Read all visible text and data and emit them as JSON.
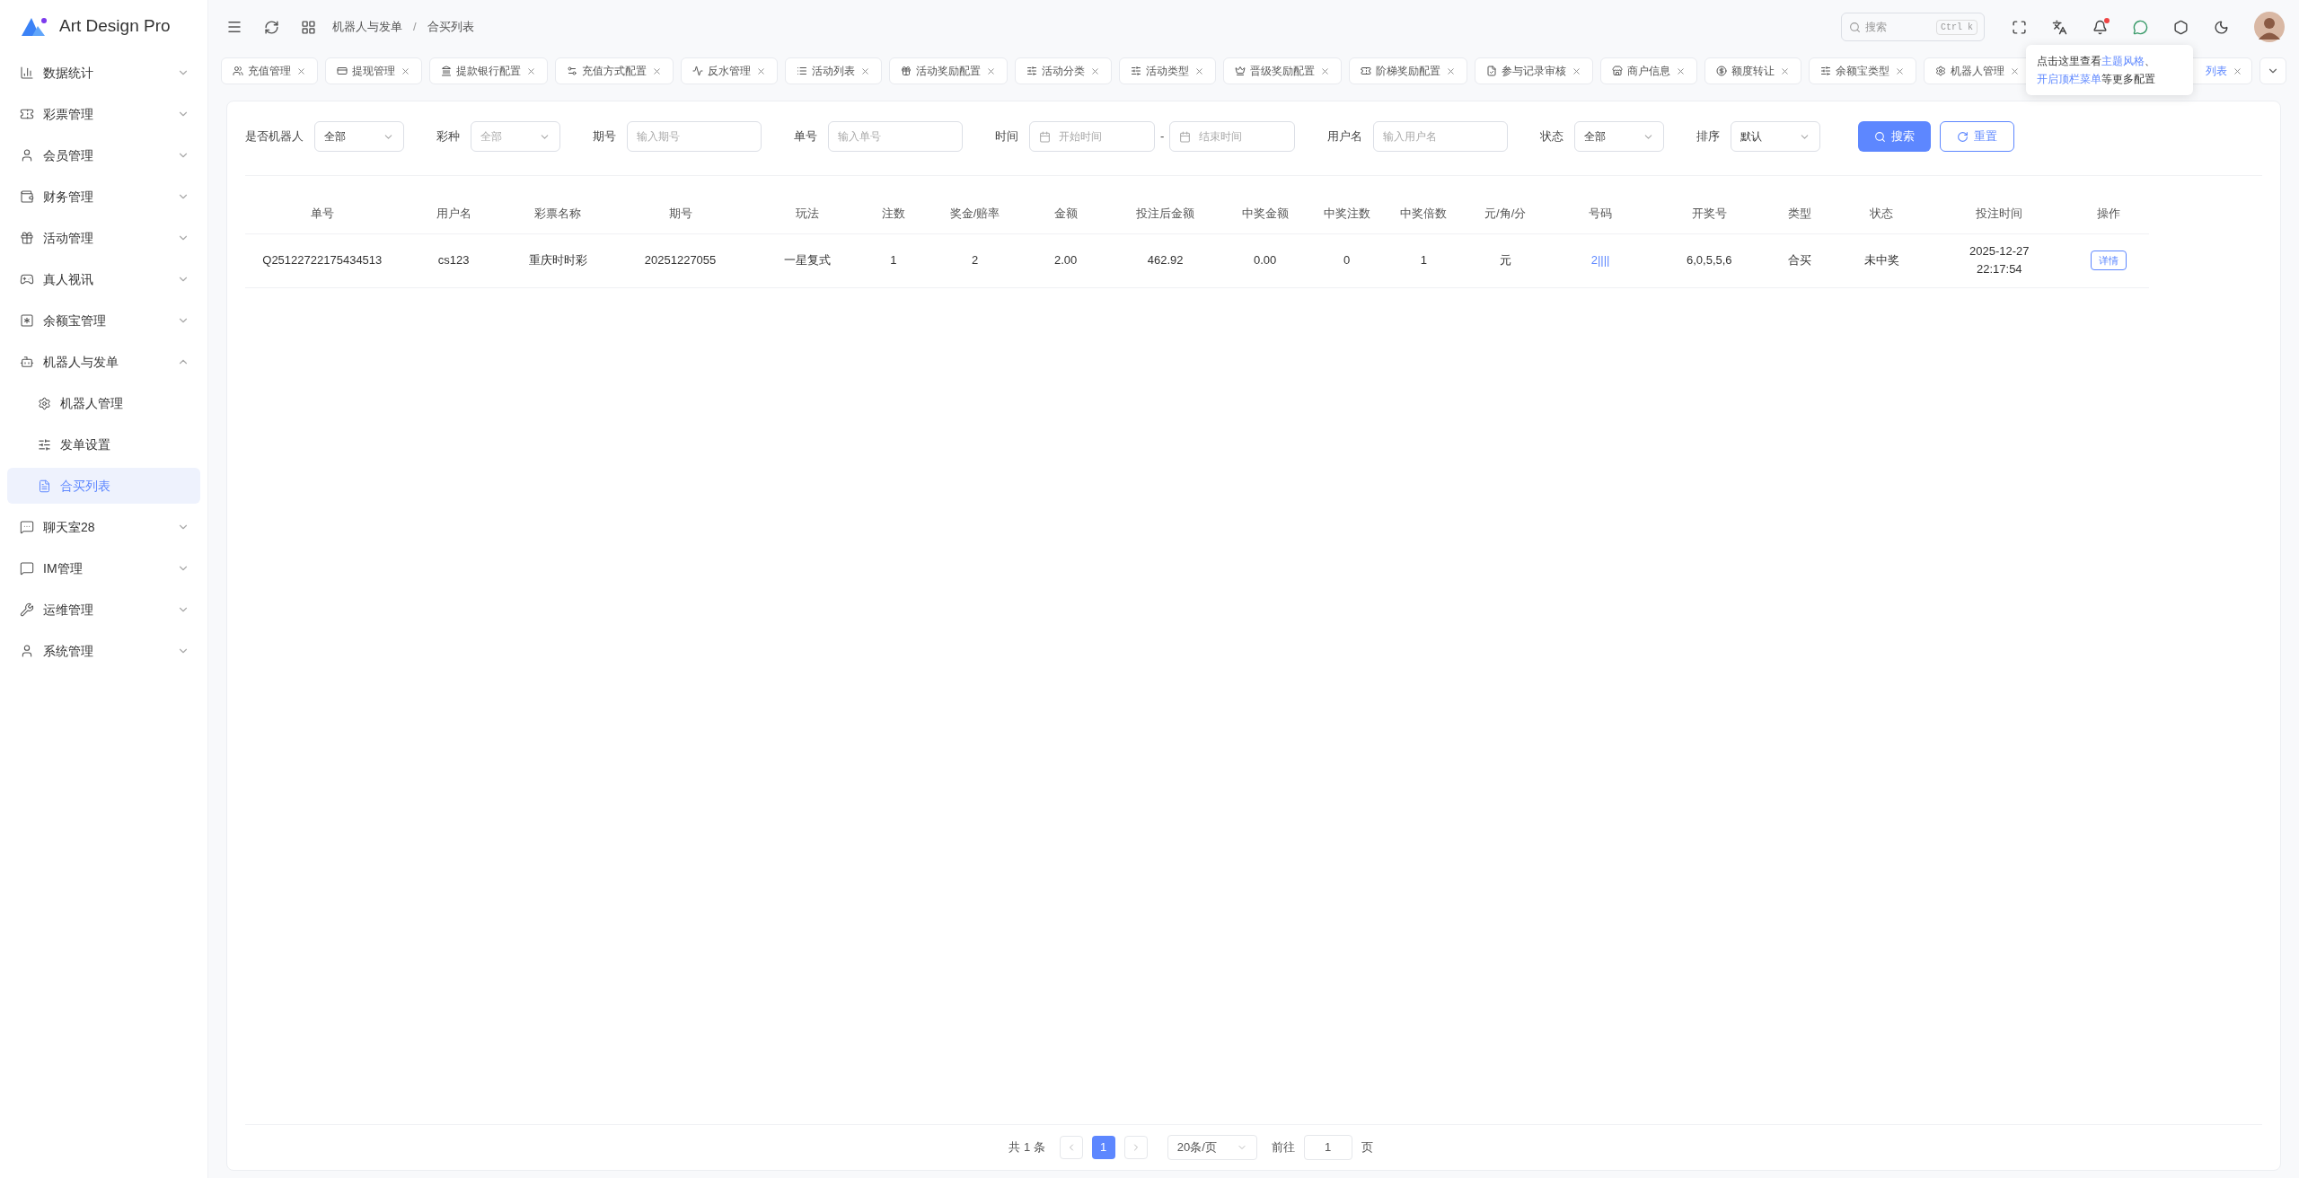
{
  "logo": {
    "title": "Art Design Pro"
  },
  "sidebar": {
    "items": [
      {
        "label": "数据统计",
        "expanded": false
      },
      {
        "label": "彩票管理",
        "expanded": false
      },
      {
        "label": "会员管理",
        "expanded": false
      },
      {
        "label": "财务管理",
        "expanded": false
      },
      {
        "label": "活动管理",
        "expanded": false
      },
      {
        "label": "真人视讯",
        "expanded": false
      },
      {
        "label": "余额宝管理",
        "expanded": false
      },
      {
        "label": "机器人与发单",
        "expanded": true,
        "children": [
          {
            "label": "机器人管理",
            "selected": false
          },
          {
            "label": "发单设置",
            "selected": false
          },
          {
            "label": "合买列表",
            "selected": true
          }
        ]
      },
      {
        "label": "聊天室28",
        "expanded": false
      },
      {
        "label": "IM管理",
        "expanded": false
      },
      {
        "label": "运维管理",
        "expanded": false
      },
      {
        "label": "系统管理",
        "expanded": false
      }
    ]
  },
  "breadcrumb": [
    "机器人与发单",
    "合买列表"
  ],
  "breadcrumb_separator": "/",
  "search": {
    "placeholder": "搜索",
    "shortcut": "Ctrl k"
  },
  "notifications": {
    "unread": true
  },
  "tabs": [
    {
      "label": "充值管理",
      "selected": false
    },
    {
      "label": "提现管理",
      "selected": false
    },
    {
      "label": "提款银行配置",
      "selected": false
    },
    {
      "label": "充值方式配置",
      "selected": false
    },
    {
      "label": "反水管理",
      "selected": false
    },
    {
      "label": "活动列表",
      "selected": false
    },
    {
      "label": "活动奖励配置",
      "selected": false
    },
    {
      "label": "活动分类",
      "selected": false
    },
    {
      "label": "活动类型",
      "selected": false
    },
    {
      "label": "晋级奖励配置",
      "selected": false
    },
    {
      "label": "阶梯奖励配置",
      "selected": false
    },
    {
      "label": "参与记录审核",
      "selected": false
    },
    {
      "label": "商户信息",
      "selected": false
    },
    {
      "label": "额度转让",
      "selected": false
    },
    {
      "label": "余额宝类型",
      "selected": false
    },
    {
      "label": "机器人管理",
      "selected": false
    },
    {
      "label": "列表",
      "selected": true
    }
  ],
  "tooltip": {
    "lines": [
      [
        {
          "kind": "text",
          "text": "点击这里查看"
        },
        {
          "kind": "link",
          "text": "主题风格"
        },
        {
          "kind": "text",
          "text": "、"
        }
      ],
      [
        {
          "kind": "link",
          "text": "开启顶栏菜单"
        },
        {
          "kind": "text",
          "text": "等更多配置"
        }
      ]
    ]
  },
  "filters": [
    {
      "kind": "select",
      "label": "是否机器人",
      "value": "全部"
    },
    {
      "kind": "select",
      "label": "彩种",
      "placeholder": "全部"
    },
    {
      "kind": "input",
      "label": "期号",
      "placeholder": "输入期号"
    },
    {
      "kind": "input",
      "label": "单号",
      "placeholder": "输入单号"
    },
    {
      "kind": "daterange",
      "label": "时间",
      "start_placeholder": "开始时间",
      "separator": "-",
      "end_placeholder": "结束时间"
    },
    {
      "kind": "input",
      "label": "用户名",
      "placeholder": "输入用户名"
    },
    {
      "kind": "select",
      "label": "状态",
      "value": "全部"
    },
    {
      "kind": "select",
      "label": "排序",
      "value": "默认"
    }
  ],
  "buttons": {
    "search": "搜索",
    "reset": "重置"
  },
  "table": {
    "columns": [
      "单号",
      "用户名",
      "彩票名称",
      "期号",
      "玩法",
      "注数",
      "奖金/赔率",
      "金额",
      "投注后金额",
      "中奖金额",
      "中奖注数",
      "中奖倍数",
      "元/角/分",
      "号码",
      "开奖号",
      "类型",
      "状态",
      "投注时间",
      "操作"
    ],
    "rows": [
      {
        "cells": [
          "Q25122722175434513",
          "cs123",
          "重庆时时彩",
          "20251227055",
          "一星复式",
          "1",
          "2",
          "2.00",
          "462.92",
          "0.00",
          "0",
          "1",
          "元",
          "2||||",
          "6,0,5,5,6",
          "合买",
          "未中奖",
          [
            "2025-12-27",
            "22:17:54"
          ]
        ],
        "action": "详情"
      }
    ]
  },
  "pagination": {
    "total": "共 1 条",
    "pages": [
      {
        "label": "1",
        "selected": true
      }
    ],
    "page_size": "20条/页",
    "goto_label": "前往",
    "goto_value": "1",
    "goto_suffix": "页"
  }
}
